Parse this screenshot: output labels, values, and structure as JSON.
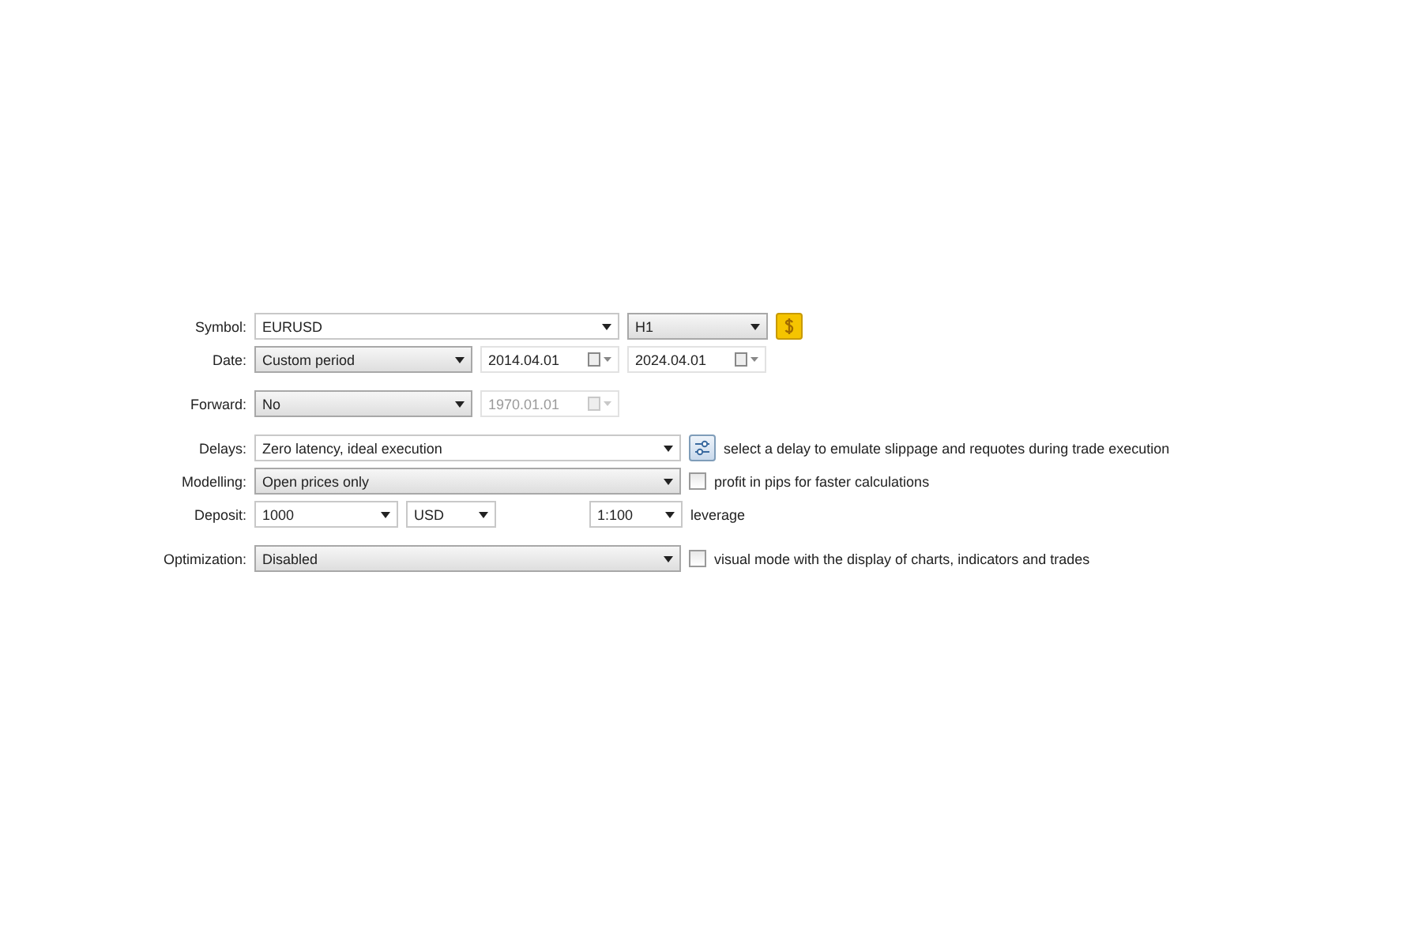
{
  "groups": [
    {
      "rows": [
        {
          "label": "Symbol:",
          "controls": [
            {
              "kind": "combo",
              "value": "EURUSD"
            },
            {
              "kind": "select",
              "value": "H1"
            },
            {
              "kind": "symbol-button"
            }
          ]
        },
        {
          "label": "Date:",
          "controls": [
            {
              "kind": "select",
              "value": "Custom period"
            },
            {
              "kind": "date",
              "value": "2014.04.01",
              "disabled": false
            },
            {
              "kind": "date",
              "value": "2024.04.01",
              "disabled": false
            }
          ]
        }
      ]
    },
    {
      "rows": [
        {
          "label": "Forward:",
          "controls": [
            {
              "kind": "select",
              "value": "No"
            },
            {
              "kind": "date",
              "value": "1970.01.01",
              "disabled": true
            }
          ]
        }
      ]
    },
    {
      "rows": [
        {
          "label": "Delays:",
          "controls": [
            {
              "kind": "combo",
              "value": "Zero latency, ideal execution"
            },
            {
              "kind": "settings-button"
            },
            {
              "kind": "text",
              "value": "select a delay to emulate slippage and requotes during trade execution"
            }
          ]
        },
        {
          "label": "Modelling:",
          "controls": [
            {
              "kind": "select",
              "value": "Open prices only"
            },
            {
              "kind": "checkbox",
              "value": "profit in pips for faster calculations",
              "checked": false
            }
          ]
        },
        {
          "label": "Deposit:",
          "controls": [
            {
              "kind": "combo",
              "value": "1000"
            },
            {
              "kind": "combo",
              "value": "USD"
            },
            {
              "kind": "combo",
              "value": "1:100"
            },
            {
              "kind": "text",
              "value": "leverage"
            }
          ]
        }
      ]
    },
    {
      "rows": [
        {
          "label": "Optimization:",
          "controls": [
            {
              "kind": "select",
              "value": "Disabled"
            },
            {
              "kind": "checkbox",
              "value": "visual mode with the display of charts, indicators and trades",
              "checked": false
            }
          ]
        }
      ]
    }
  ]
}
